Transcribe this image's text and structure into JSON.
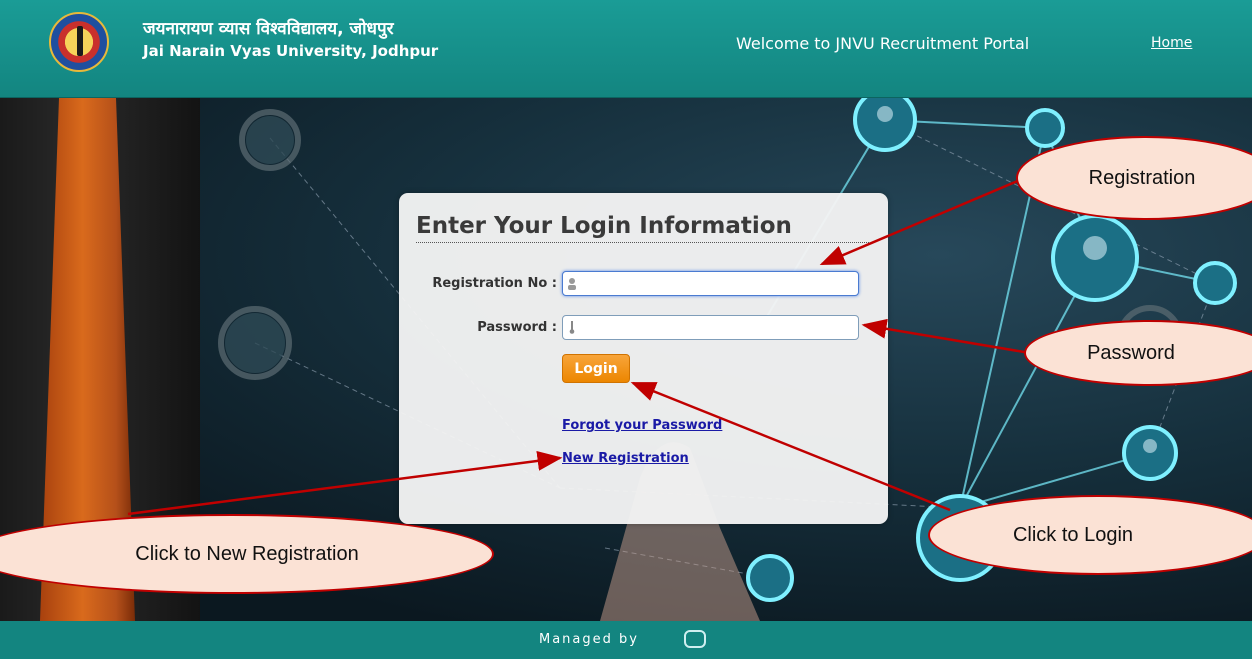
{
  "header": {
    "title_hindi": "जयनारायण व्यास विश्वविद्यालय, जोधपुर",
    "title_english": "Jai Narain Vyas University, Jodhpur",
    "welcome": "Welcome to JNVU Recruitment Portal",
    "home_link": "Home"
  },
  "login": {
    "heading": "Enter Your Login Information",
    "registration_label": "Registration No :",
    "registration_value": "",
    "password_label": "Password :",
    "password_value": "",
    "login_button": "Login",
    "forgot_link": "Forgot your Password",
    "new_registration_link": "New Registration"
  },
  "callouts": {
    "registration": "Registration",
    "password": "Password",
    "click_login": "Click to Login",
    "click_new_registration": "Click to New Registration"
  },
  "footer": {
    "managed_by": "Managed by"
  },
  "colors": {
    "header_bg": "#1a9c96",
    "login_button": "#f39419",
    "callout_fill": "#fbe2d5",
    "callout_border": "#c00000",
    "link": "#1a1aa6"
  }
}
